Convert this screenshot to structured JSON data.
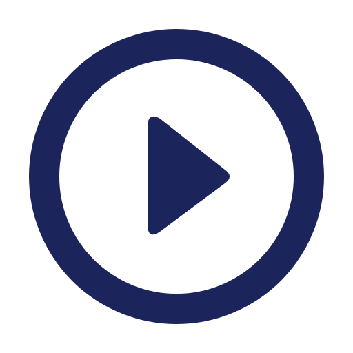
{
  "icon": {
    "name": "play-circle-icon",
    "color": "#1c255b",
    "background": "#ffffff"
  }
}
